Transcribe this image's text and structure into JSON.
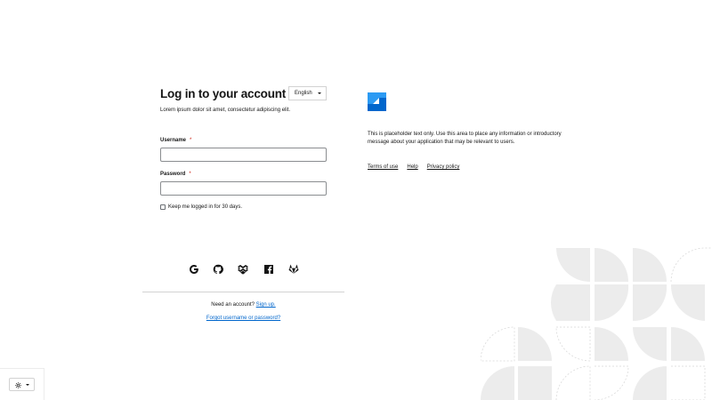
{
  "login": {
    "title": "Log in to your account",
    "subtitle": "Lorem ipsum dolor sit amet, consectetur adipiscing elit.",
    "language": "English",
    "username_label": "Username",
    "password_label": "Password",
    "required_mark": "*",
    "remember_label": "Keep me logged in for 30 days."
  },
  "social": {
    "icons": [
      "google-icon",
      "github-icon",
      "dropbox-icon",
      "facebook-icon",
      "gitlab-icon"
    ]
  },
  "signup": {
    "prompt": "Need an account?",
    "link": "Sign up."
  },
  "forgot": {
    "link": "Forgot username or password?"
  },
  "info": {
    "text": "This is placeholder text only. Use this area to place any information or introductory message about your application that may be relevant to users."
  },
  "footer": {
    "terms": "Terms of use",
    "help": "Help",
    "privacy": "Privacy policy"
  },
  "colors": {
    "link": "#0066cc",
    "brand": "#0066cc",
    "required": "#c9190b",
    "background_shapes": "#f0f0f0"
  }
}
